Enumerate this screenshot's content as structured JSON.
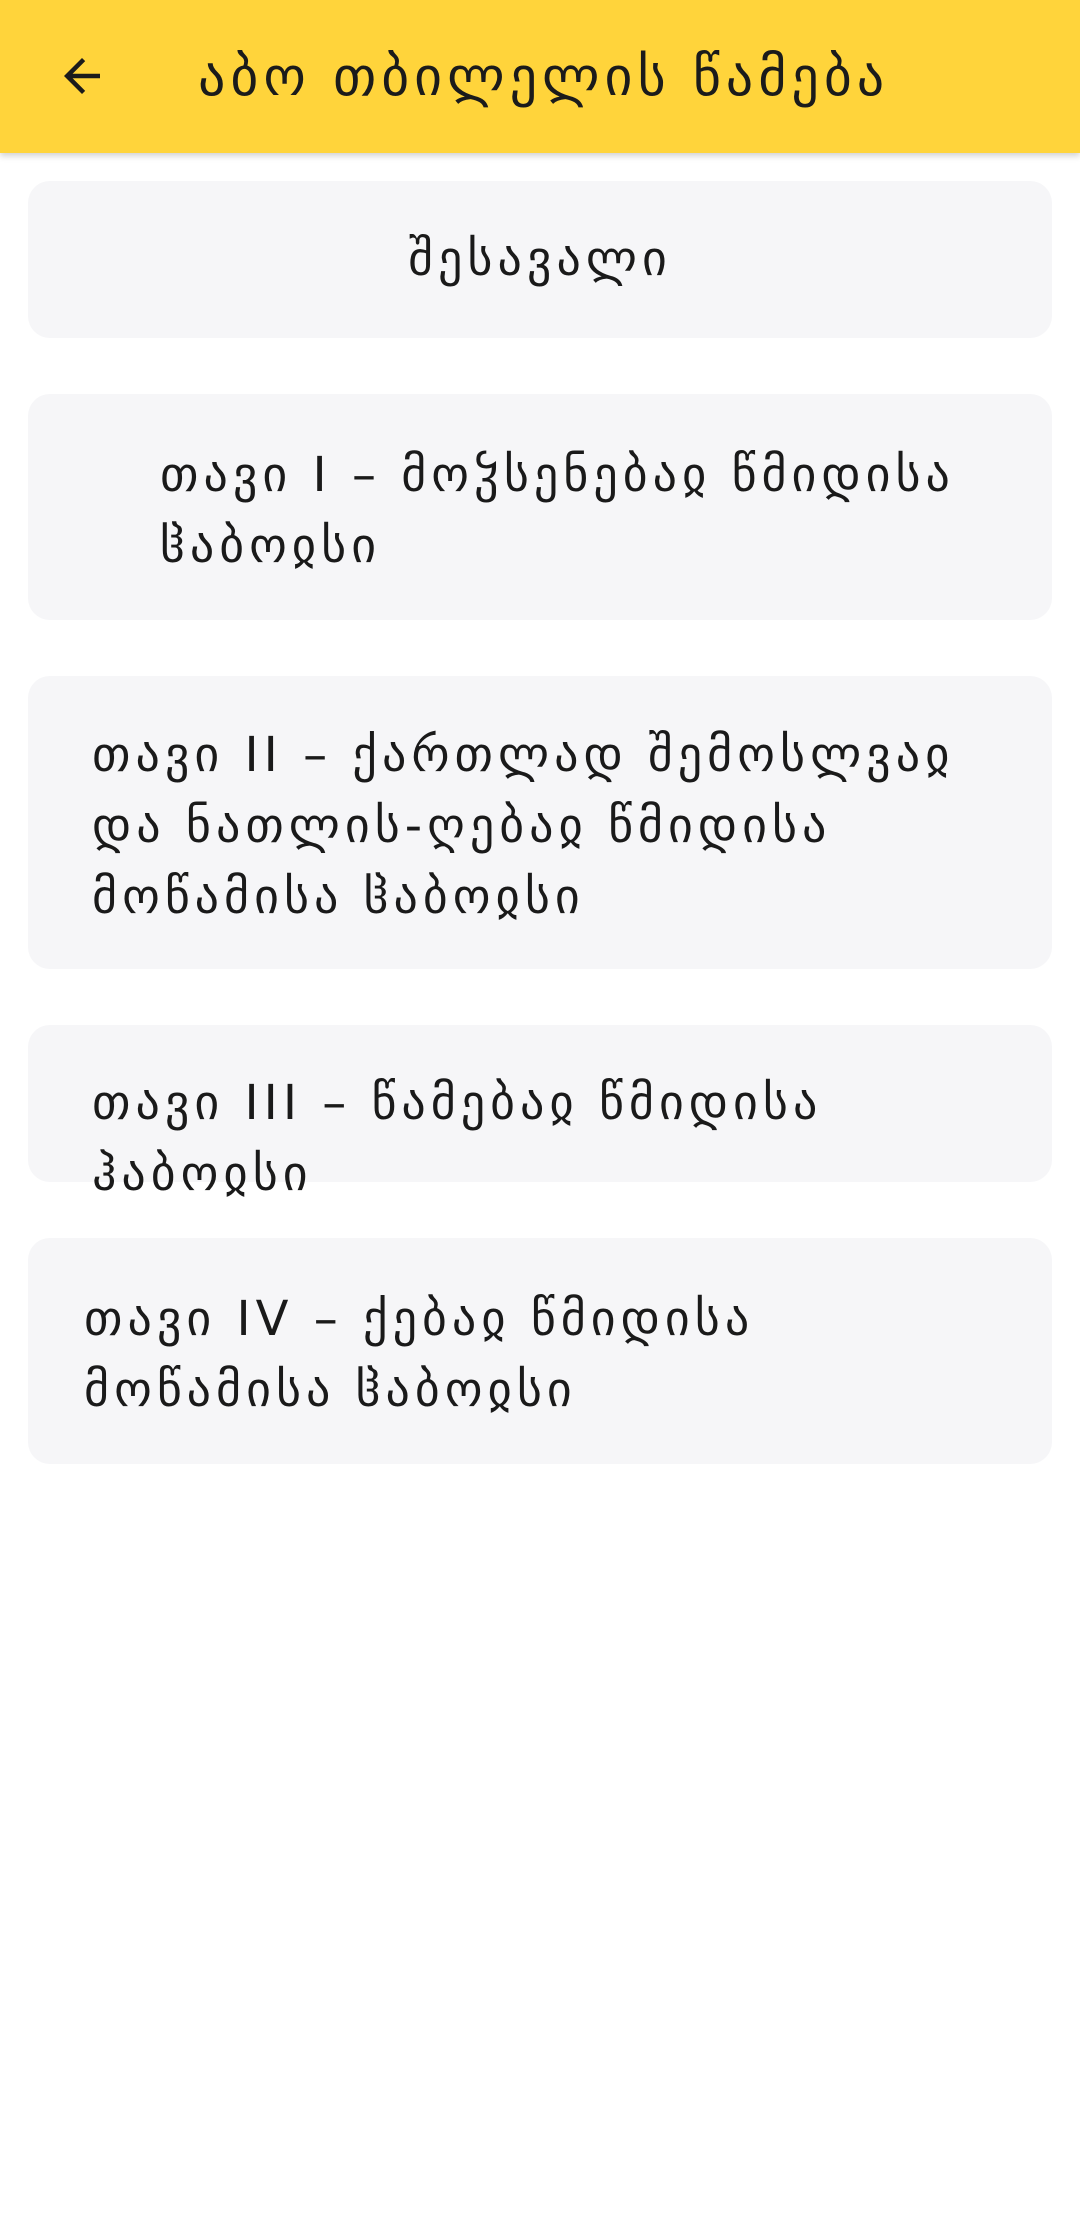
{
  "app_bar": {
    "title": "აბო თბილელის წამება",
    "back_icon": "arrow-left-icon",
    "background": "#FFD43B"
  },
  "chapters": [
    {
      "label": "შესავალი"
    },
    {
      "label": "თავი I – მოჴსენებაჲ წმიდისა ჱაბოჲსი"
    },
    {
      "label": "თავი II – ქართლად შემოსლვაჲ და ნათლის-ღებაჲ წმიდისა მოწამისა ჱაბოჲსი"
    },
    {
      "label": "თავი III – წამებაჲ წმიდისა ჰაბოჲსი"
    },
    {
      "label": "თავი  IV – ქებაჲ წმიდისა მოწამისა ჱაბოჲსი"
    }
  ]
}
